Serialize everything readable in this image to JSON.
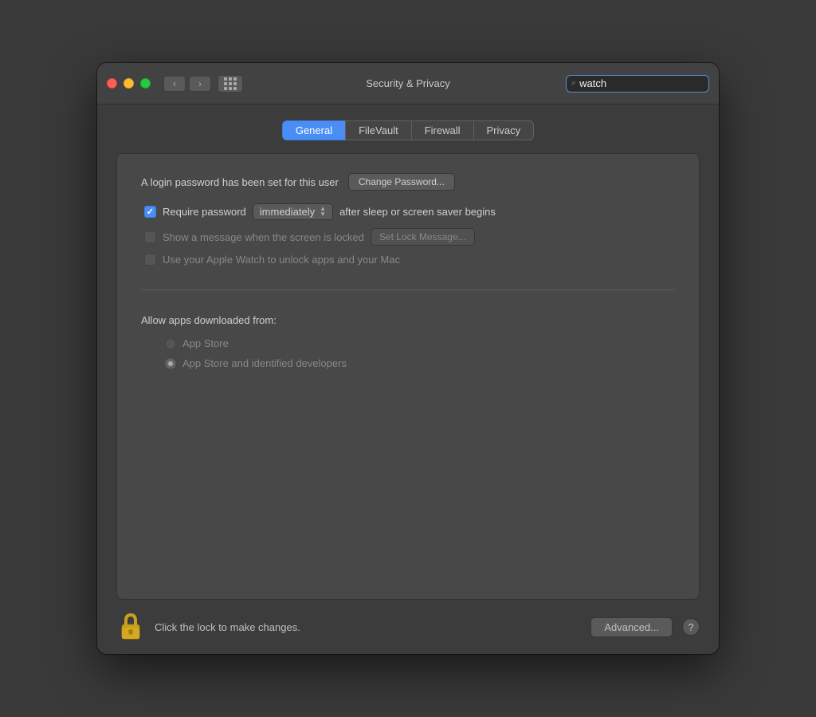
{
  "window": {
    "title": "Security & Privacy",
    "search_placeholder": "watch",
    "search_value": "watch"
  },
  "titlebar": {
    "back_label": "‹",
    "forward_label": "›",
    "search_icon": "🔍"
  },
  "tabs": [
    {
      "id": "general",
      "label": "General",
      "active": true
    },
    {
      "id": "filevault",
      "label": "FileVault",
      "active": false
    },
    {
      "id": "firewall",
      "label": "Firewall",
      "active": false
    },
    {
      "id": "privacy",
      "label": "Privacy",
      "active": false
    }
  ],
  "panel": {
    "login_password_text": "A login password has been set for this user",
    "change_password_btn": "Change Password...",
    "require_password_label": "Require password",
    "require_password_dropdown": "immediately",
    "after_sleep_text": "after sleep or screen saver begins",
    "show_message_label": "Show a message when the screen is locked",
    "set_lock_message_btn": "Set Lock Message...",
    "apple_watch_label": "Use your Apple Watch to unlock apps and your Mac",
    "allow_apps_label": "Allow apps downloaded from:",
    "radio_options": [
      {
        "id": "app-store",
        "label": "App Store",
        "selected": false
      },
      {
        "id": "app-store-identified",
        "label": "App Store and identified developers",
        "selected": true
      }
    ]
  },
  "footer": {
    "lock_text": "Click the lock to make changes.",
    "advanced_btn": "Advanced...",
    "help_label": "?"
  }
}
